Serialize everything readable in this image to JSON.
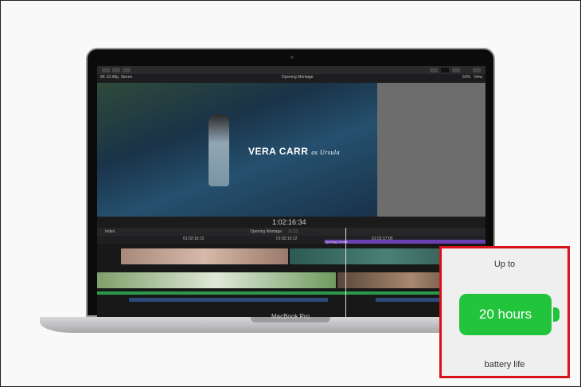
{
  "app": {
    "format": "8K 23.98p, Stereo",
    "project": "Opening Montage",
    "zoom": "50%",
    "view": "View",
    "title_name": "VERA CARR",
    "title_role": "as Ursula",
    "timecode": "1:02:16:34",
    "index": "Index",
    "timeline_project": "Opening Montage",
    "duration": "11:23",
    "ruler": [
      "01:02:16:12",
      "01:02:16:12",
      "01:02:17:00"
    ],
    "clip_title": "Opening Credits"
  },
  "device": {
    "label": "MacBook Pro"
  },
  "callout": {
    "prefix": "Up to",
    "value": "20 hours",
    "suffix": "battery life",
    "color": "#22c43c",
    "border": "#d8141a"
  }
}
